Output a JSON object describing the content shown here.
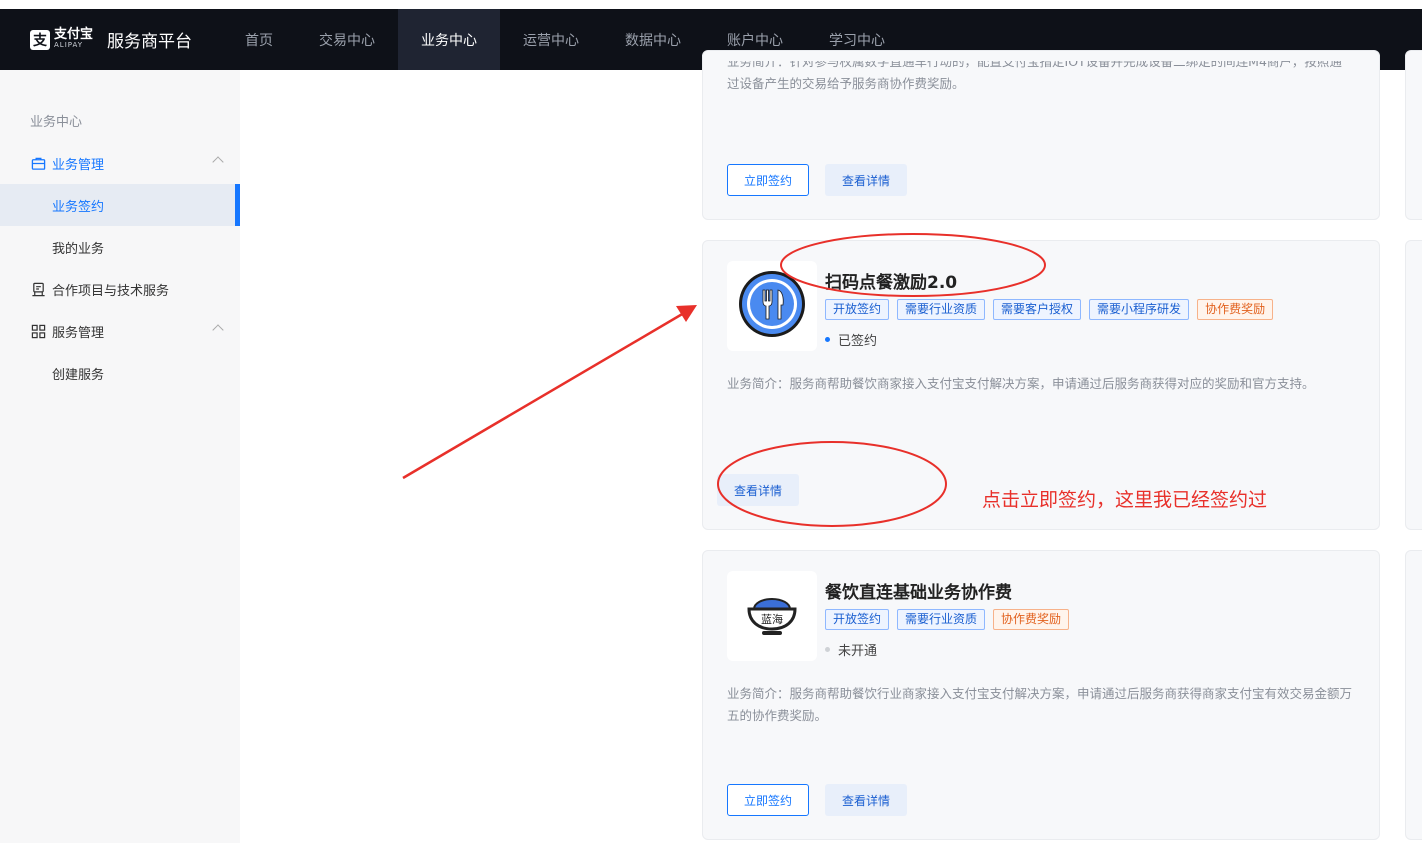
{
  "brand": {
    "logo_char": "支",
    "logo_text": "支付宝",
    "logo_sub": "ALIPAY",
    "title": "服务商平台"
  },
  "nav": [
    {
      "label": "首页",
      "active": false
    },
    {
      "label": "交易中心",
      "active": false
    },
    {
      "label": "业务中心",
      "active": true
    },
    {
      "label": "运营中心",
      "active": false
    },
    {
      "label": "数据中心",
      "active": false
    },
    {
      "label": "账户中心",
      "active": false
    },
    {
      "label": "学习中心",
      "active": false
    }
  ],
  "sidebar": {
    "heading": "业务中心",
    "items": [
      {
        "label": "业务管理",
        "icon": "briefcase-icon"
      },
      {
        "label": "业务签约"
      },
      {
        "label": "我的业务"
      },
      {
        "label": "合作项目与技术服务",
        "icon": "cooperation-icon"
      },
      {
        "label": "服务管理",
        "icon": "grid-icon"
      },
      {
        "label": "创建服务"
      }
    ]
  },
  "cards": [
    {
      "desc": "业务简介：针对参与权属数字直通车行动的，配置支付宝指定IOT设备并完成设备二绑定的间连M4商户，按照通过设备产生的交易给予服务商协作费奖励。",
      "sign_label": "立即签约",
      "detail_label": "查看详情"
    },
    {
      "title": "扫码点餐激励2.0",
      "tags": [
        "开放签约",
        "需要行业资质",
        "需要客户授权",
        "需要小程序研发"
      ],
      "reward_tag": "协作费奖励",
      "status": "已签约",
      "desc": "业务简介：服务商帮助餐饮商家接入支付宝支付解决方案，申请通过后服务商获得对应的奖励和官方支持。",
      "detail_label": "查看详情",
      "icon": "fork-knife-icon"
    },
    {
      "title": "餐饮直连基础业务协作费",
      "tags": [
        "开放签约",
        "需要行业资质"
      ],
      "reward_tag": "协作费奖励",
      "status": "未开通",
      "desc": "业务简介：服务商帮助餐饮行业商家接入支付宝支付解决方案，申请通过后服务商获得商家支付宝有效交易金额万五的协作费奖励。",
      "sign_label": "立即签约",
      "detail_label": "查看详情",
      "icon": "bowl-icon",
      "icon_text": "蓝海"
    }
  ],
  "annotation": {
    "text": "点击立即签约，这里我已经签约过",
    "color": "#e8302a"
  },
  "colors": {
    "accent": "#1677ff",
    "topbar": "#0e1118",
    "reward": "#e2621f"
  }
}
